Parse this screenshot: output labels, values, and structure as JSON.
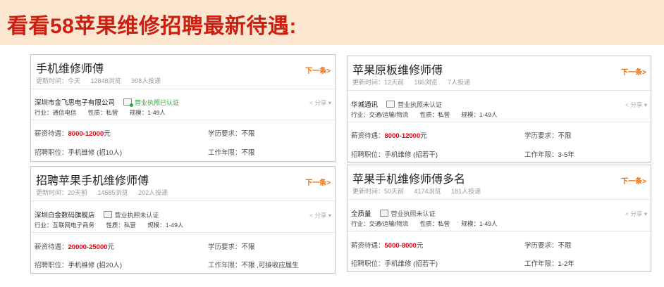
{
  "banner": {
    "title": "看看58苹果维修招聘最新待遇:"
  },
  "cards": [
    {
      "title": "手机维修师傅",
      "next": "下一条>",
      "updated": "更新时间：今天",
      "views": "12848浏览",
      "applies": "308人投递",
      "company": "深圳市金飞思电子有限公司",
      "license": "营业执照已认证",
      "share": "< 分享 ▾",
      "industry": "行业：通信电信",
      "nature": "性质：私营",
      "scale": "规模：1-49人",
      "salary_label": "薪资待遇：",
      "salary": "8000-12000",
      "salary_unit": "元",
      "edu_label": "学历要求：",
      "edu": "不限",
      "position_label": "招聘职位：",
      "position": "手机维修 (招10人)",
      "exp_label": "工作年限：",
      "exp": "不限"
    },
    {
      "title": "苹果原板维修师傅",
      "next": "下一条>",
      "updated": "更新时间：12天前",
      "views": "166浏览",
      "applies": "7人投递",
      "company": "华城通讯",
      "license": "营业执照未认证",
      "share": "< 分享 ▾",
      "industry": "行业：交通/运输/物流",
      "nature": "性质：私营",
      "scale": "规模：1-49人",
      "salary_label": "薪资待遇：",
      "salary": "8000-12000",
      "salary_unit": "元",
      "edu_label": "学历要求：",
      "edu": "不限",
      "position_label": "招聘职位：",
      "position": "手机维修 (招若干)",
      "exp_label": "工作年限：",
      "exp": "3-5年"
    },
    {
      "title": "招聘苹果手机维修师傅",
      "next": "下一条>",
      "updated": "更新时间：20天前",
      "views": "14585浏览",
      "applies": "202人投递",
      "company": "深圳白金数码旗舰店",
      "license": "营业执照未认证",
      "share": "< 分享 ▾",
      "industry": "行业：互联网电子商务",
      "nature": "性质：私营",
      "scale": "规模：1-49人",
      "salary_label": "薪资待遇：",
      "salary": "20000-25000",
      "salary_unit": "元",
      "edu_label": "学历要求：",
      "edu": "不限",
      "position_label": "招聘职位：",
      "position": "手机维修 (招20人)",
      "exp_label": "工作年限：",
      "exp": "不限 ,可接收应届生"
    },
    {
      "title": "苹果手机维修师傅多名",
      "next": "下一条>",
      "updated": "更新时间：50天前",
      "views": "4174浏览",
      "applies": "181人投递",
      "company": "全质量",
      "license": "营业执照未认证",
      "share": "< 分享 ▾",
      "industry": "行业：交通/运输/物流",
      "nature": "性质：私营",
      "scale": "规模：1-49人",
      "salary_label": "薪资待遇：",
      "salary": "5000-8000",
      "salary_unit": "元",
      "edu_label": "学历要求：",
      "edu": "不限",
      "position_label": "招聘职位：",
      "position": "手机维修 (招若干)",
      "exp_label": "工作年限：",
      "exp": "1-2年"
    }
  ]
}
